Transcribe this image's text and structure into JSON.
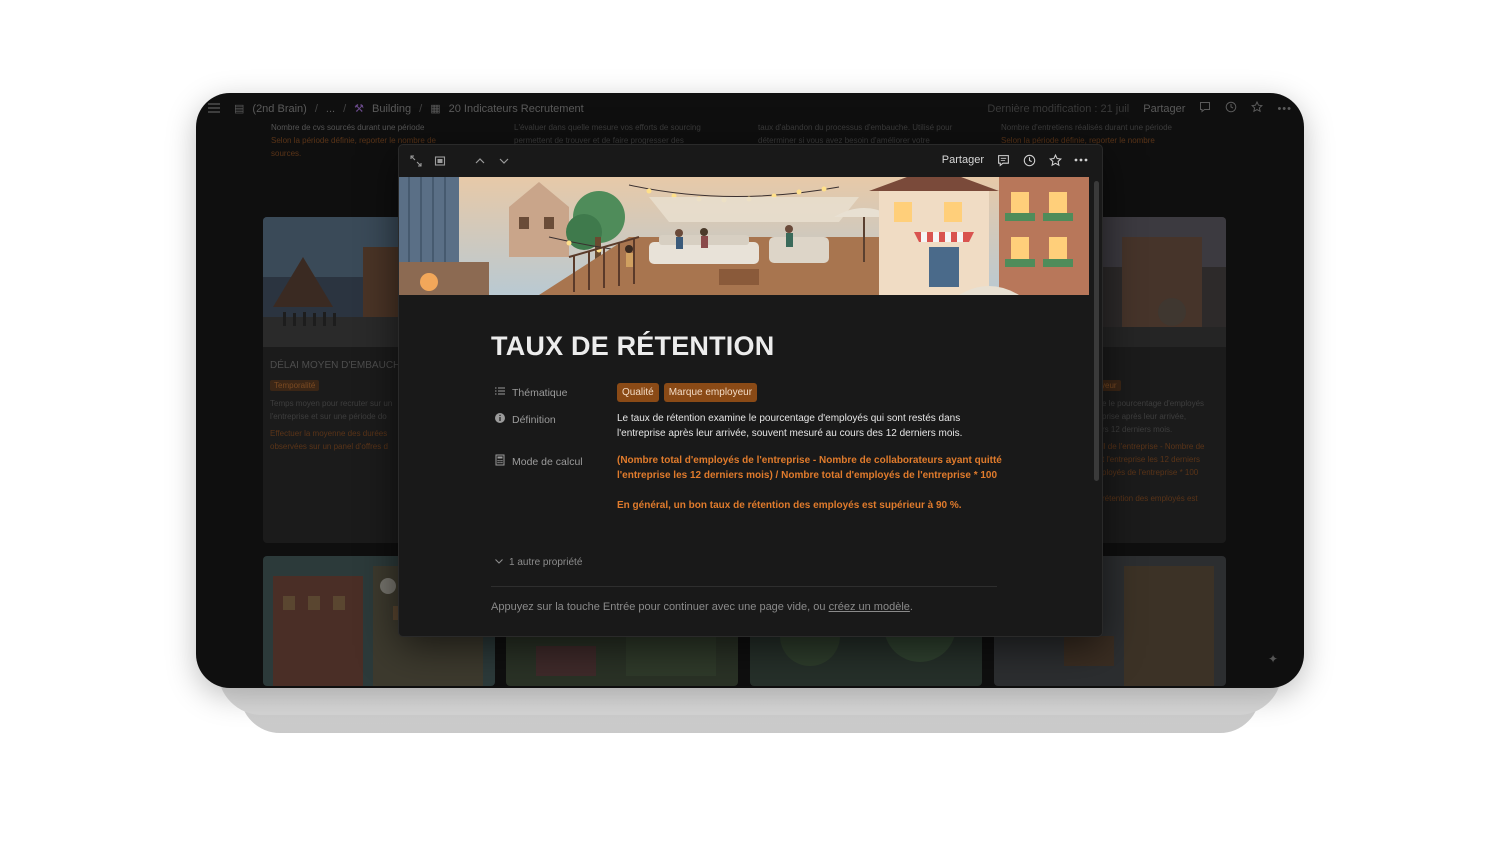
{
  "topbar": {
    "breadcrumbs": [
      "(2nd Brain)",
      "...",
      "Building",
      "20 Indicateurs Recrutement"
    ],
    "edited": "Dernière modification : 21 juil",
    "share": "Partager"
  },
  "background": {
    "top_texts": [
      {
        "line1": "Nombre de cvs sourcés durant une période",
        "line2": "Selon la période définie, reporter le nombre de",
        "line3": "sources."
      },
      {
        "line1": "L'évaluer dans quelle mesure vos efforts de sourcing",
        "line2": "permettent de trouver et de faire progresser des"
      },
      {
        "line1": "taux d'abandon du processus d'embauche. Utilisé pour",
        "line2": "déterminer si vous avez besoin d'améliorer votre"
      },
      {
        "line1": "Nombre d'entretiens réalisés durant une période",
        "line2": "Selon la période définie, reporter le nombre"
      }
    ],
    "card_left": {
      "title": "DÉLAI MOYEN D'EMBAUCHE",
      "tag": "Temporalité",
      "desc1": "Temps moyen pour recruter sur un",
      "desc2": "l'entreprise et sur une période do",
      "calc1": "Effectuer la moyenne des durées",
      "calc2": "observées sur un panel d'offres d"
    },
    "card_right": {
      "tag": "yeur",
      "desc1": "e le pourcentage d'employés",
      "desc2": "prise après leur arrivée,",
      "desc3": "rs 12 derniers mois.",
      "calc1": "ll de l'entreprise - Nombre de",
      "calc2": "t l'entreprise les 12 derniers",
      "calc3": "ployés de l'entreprise * 100",
      "calc4": "rétention des employés est"
    }
  },
  "modal": {
    "share": "Partager",
    "title": "TAUX DE RÉTENTION",
    "properties": {
      "thematique_label": "Thématique",
      "thematique_tags": [
        "Qualité",
        "Marque employeur"
      ],
      "definition_label": "Définition",
      "definition_line1": "Le taux de rétention examine le pourcentage d'employés qui sont restés dans",
      "definition_line2": "l'entreprise après leur arrivée, souvent mesuré au cours des 12 derniers mois.",
      "calcul_label": "Mode de calcul",
      "calcul_line1": "(Nombre total d'employés de l'entreprise - Nombre de collaborateurs ayant quitté",
      "calcul_line2": "l'entreprise les 12 derniers mois) / Nombre total d'employés de l'entreprise * 100",
      "calcul_line3": "En général, un bon taux de rétention des employés est supérieur à 90 %."
    },
    "more_properties": "1 autre propriété",
    "hint_text": "Appuyez sur la touche Entrée pour continuer avec une page vide, ou ",
    "hint_link": "créez un modèle",
    "hint_end": "."
  },
  "colors": {
    "accent_orange": "#e07b2c",
    "tag_bg": "#8a4a16",
    "modal_bg": "#191919"
  }
}
